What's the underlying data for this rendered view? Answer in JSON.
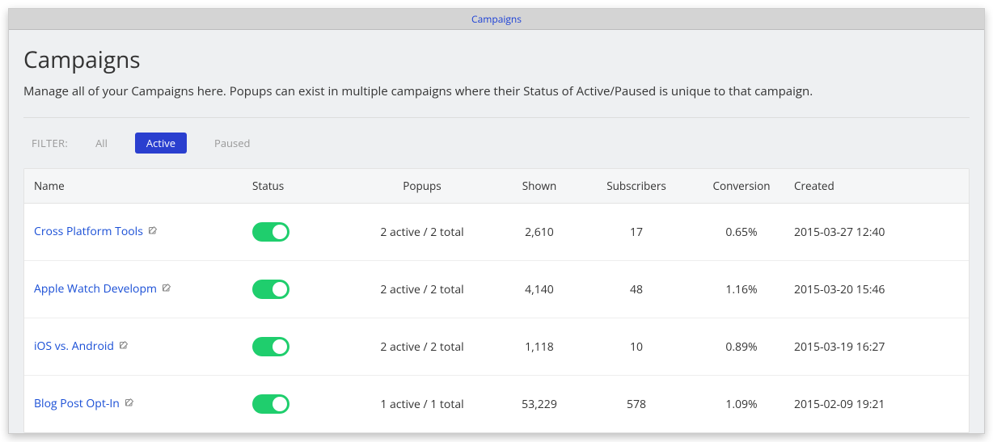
{
  "tab": {
    "label": "Campaigns"
  },
  "header": {
    "title": "Campaigns",
    "subtitle": "Manage all of your Campaigns here. Popups can exist in multiple campaigns where their Status of Active/Paused is unique to that campaign."
  },
  "filter": {
    "label": "FILTER:",
    "options": [
      "All",
      "Active",
      "Paused"
    ],
    "active": "Active"
  },
  "table": {
    "headers": {
      "name": "Name",
      "status": "Status",
      "popups": "Popups",
      "shown": "Shown",
      "subscribers": "Subscribers",
      "conversion": "Conversion",
      "created": "Created"
    },
    "rows": [
      {
        "name": "Cross Platform Tools",
        "status": "active",
        "popups": "2 active / 2 total",
        "shown": "2,610",
        "subscribers": "17",
        "conversion": "0.65%",
        "created": "2015-03-27 12:40"
      },
      {
        "name": "Apple Watch Developm",
        "status": "active",
        "popups": "2 active / 2 total",
        "shown": "4,140",
        "subscribers": "48",
        "conversion": "1.16%",
        "created": "2015-03-20 15:46"
      },
      {
        "name": "iOS vs. Android",
        "status": "active",
        "popups": "2 active / 2 total",
        "shown": "1,118",
        "subscribers": "10",
        "conversion": "0.89%",
        "created": "2015-03-19 16:27"
      },
      {
        "name": "Blog Post Opt-In",
        "status": "active",
        "popups": "1 active / 1 total",
        "shown": "53,229",
        "subscribers": "578",
        "conversion": "1.09%",
        "created": "2015-02-09 19:21"
      }
    ]
  }
}
